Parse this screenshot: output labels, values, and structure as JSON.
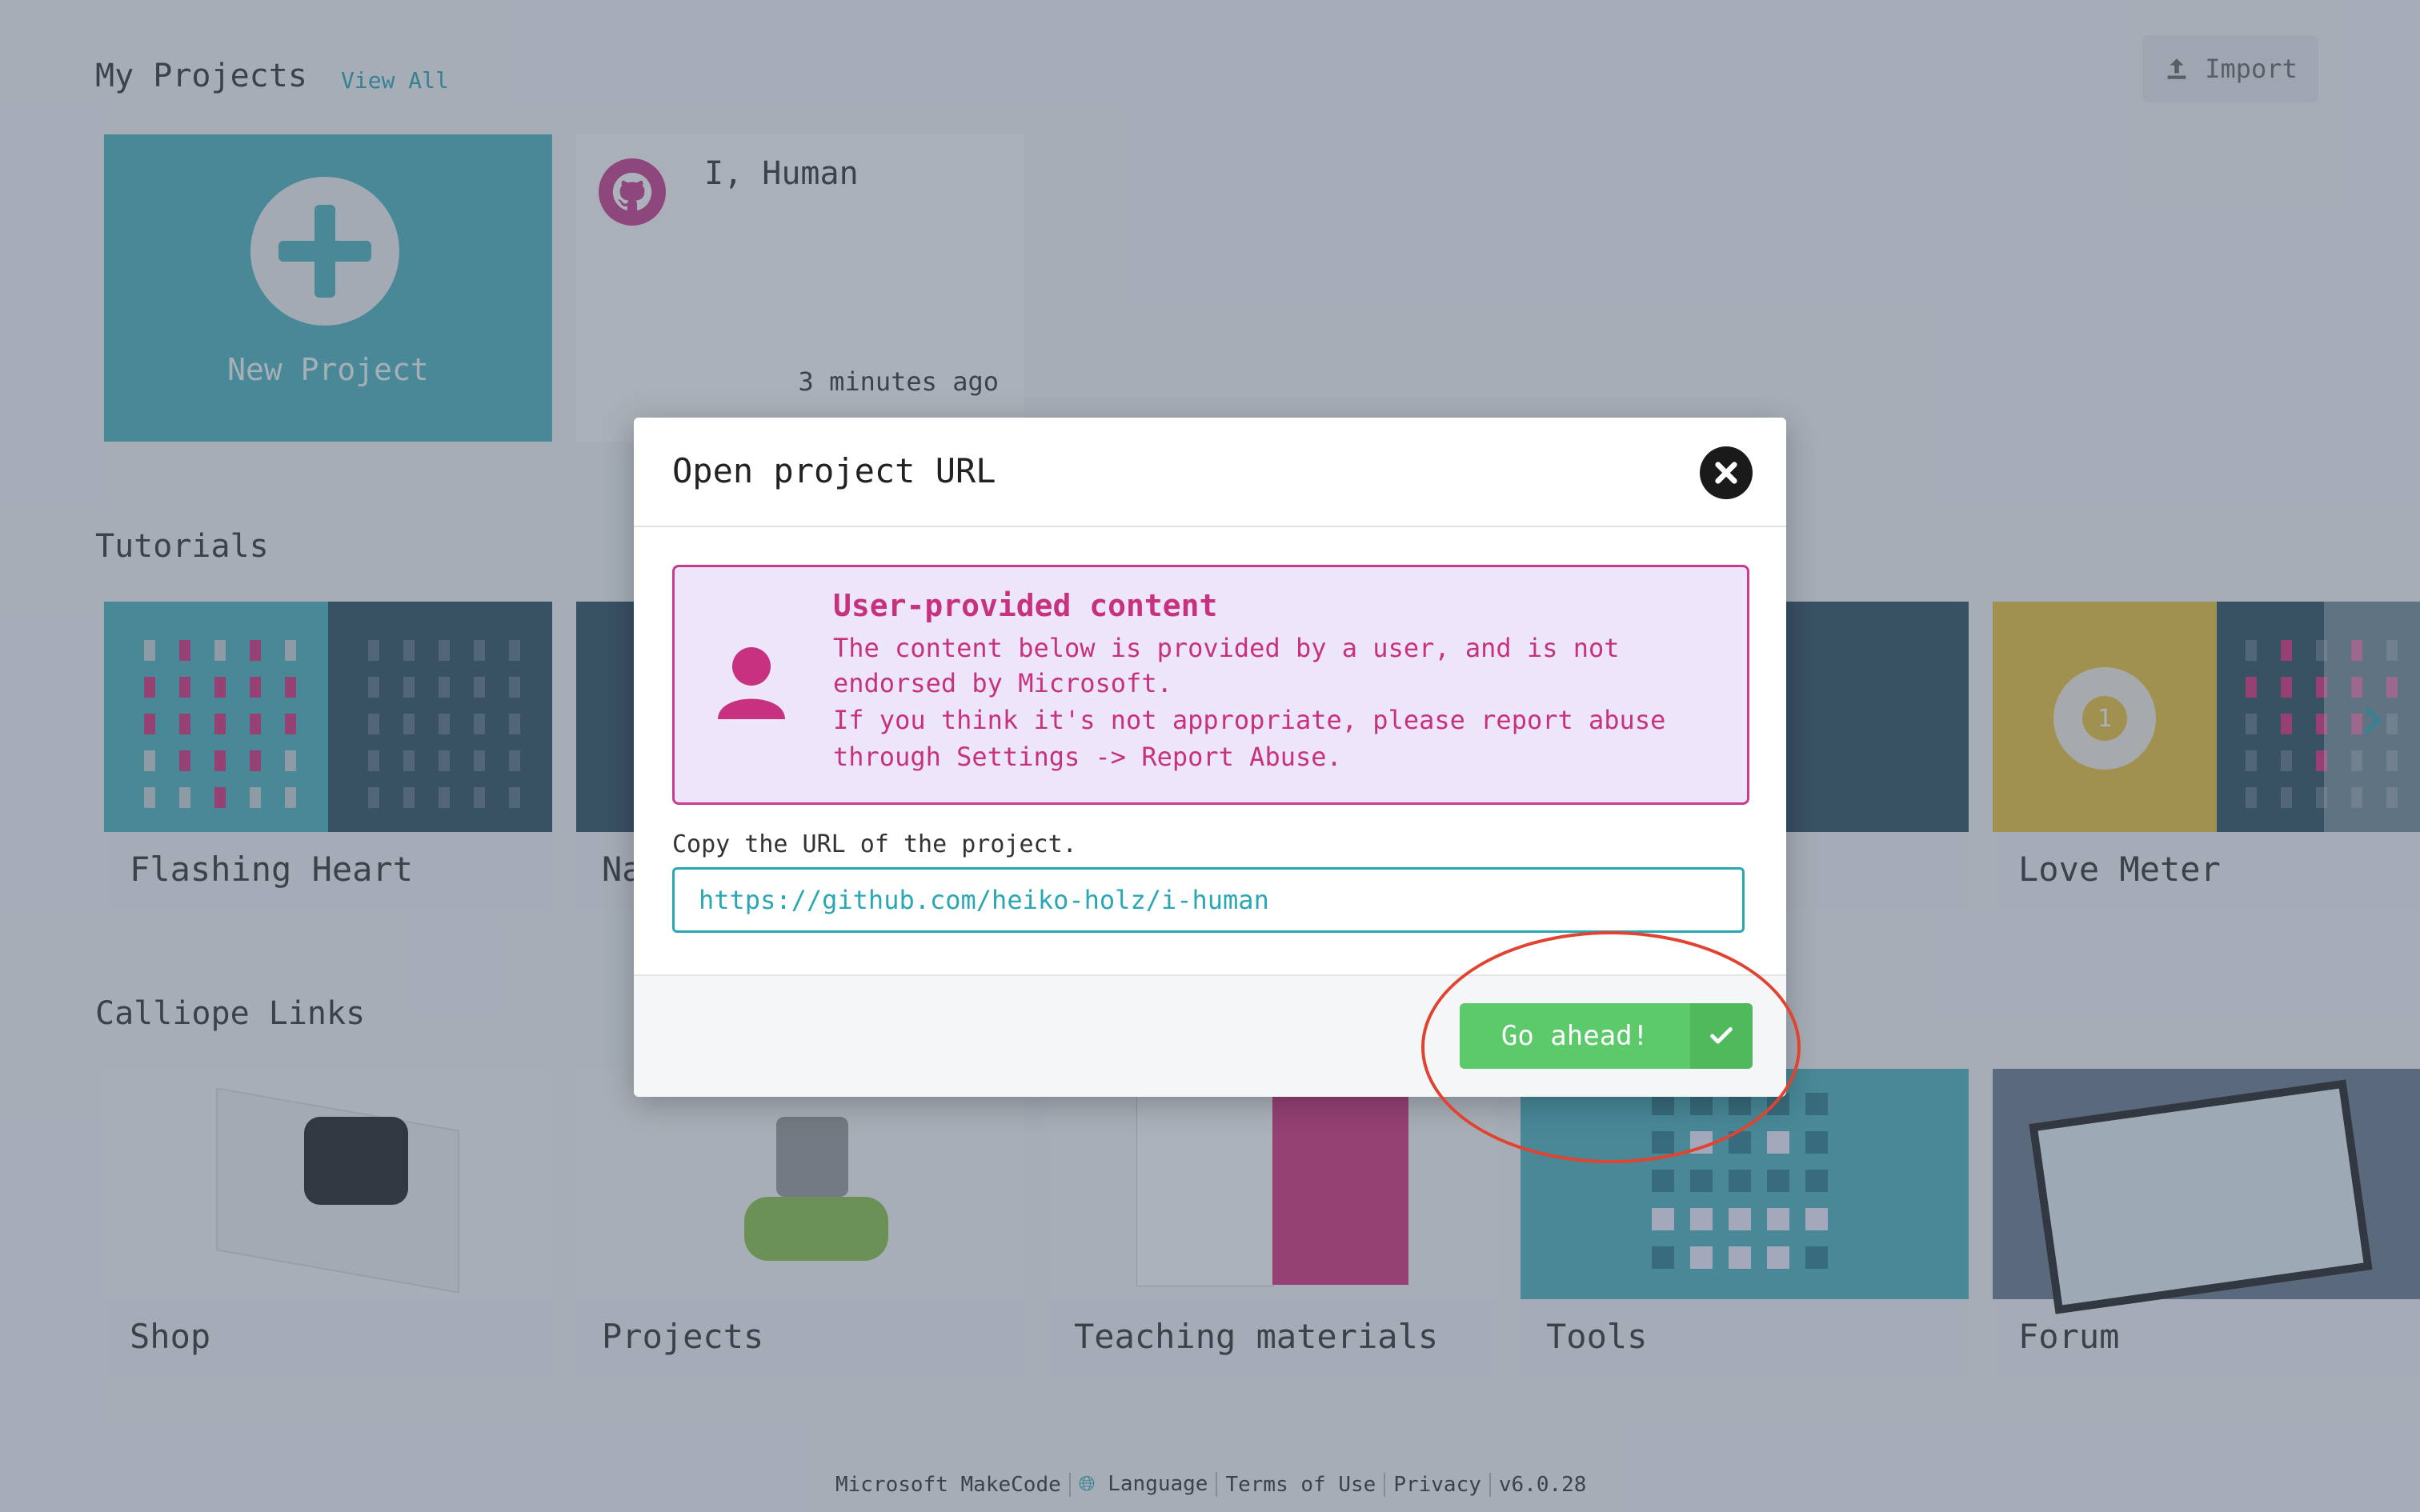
{
  "my_projects": {
    "title": "My Projects",
    "view_all": "View All"
  },
  "import_label": "Import",
  "new_project": "New Project",
  "repo_project": {
    "name": "I, Human",
    "time": "3 minutes ago"
  },
  "tutorials": {
    "title": "Tutorials",
    "items": [
      "Flashing Heart",
      "Na",
      "Love Meter"
    ],
    "love_meter_badge": "1"
  },
  "links": {
    "title": "Calliope Links",
    "items": [
      "Shop",
      "Projects",
      "Teaching materials",
      "Tools",
      "Forum"
    ]
  },
  "footer": {
    "brand": "Microsoft MakeCode",
    "language": "Language",
    "terms": "Terms of Use",
    "privacy": "Privacy",
    "version": "v6.0.28"
  },
  "modal": {
    "title": "Open project URL",
    "warning_title": "User-provided content",
    "warning_lines": [
      "The content below is provided by a user, and is not",
      "endorsed by Microsoft.",
      "If you think it's not appropriate, please report abuse",
      "through Settings -> Report Abuse."
    ],
    "url_label": "Copy the URL of the project.",
    "url_value": "https://github.com/heiko-holz/i-human",
    "confirm_label": "Go ahead!"
  },
  "colors": {
    "accent": "#2aa7b5",
    "warning": "#c8317f",
    "confirm": "#5cc96a",
    "highlight": "#e0432f"
  }
}
